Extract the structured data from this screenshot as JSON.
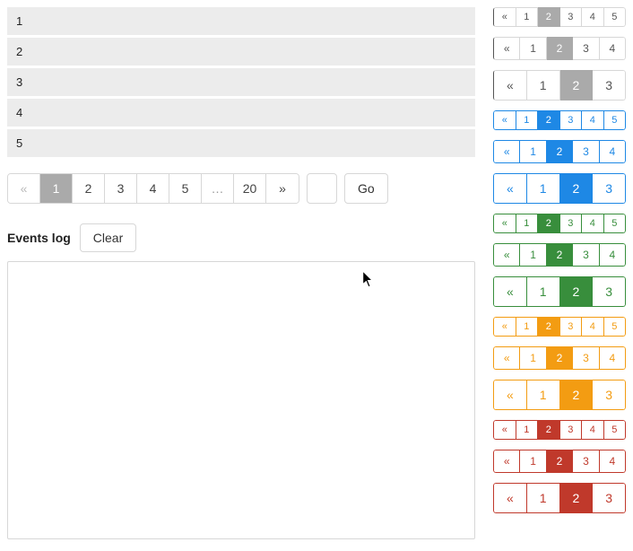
{
  "list": {
    "items": [
      "1",
      "2",
      "3",
      "4",
      "5"
    ]
  },
  "pager": {
    "prev": "«",
    "pages": [
      "1",
      "2",
      "3",
      "4",
      "5"
    ],
    "dots": "…",
    "last": "20",
    "next": "»",
    "active_index": 0
  },
  "page_input": {
    "value": ""
  },
  "go": {
    "label": "Go"
  },
  "events": {
    "title": "Events log",
    "clear_label": "Clear"
  },
  "minis": [
    {
      "color": "gray",
      "size": "s",
      "cells": [
        "«",
        "1",
        "2",
        "3",
        "4",
        "5"
      ],
      "active": 2
    },
    {
      "color": "gray",
      "size": "m",
      "cells": [
        "«",
        "1",
        "2",
        "3",
        "4"
      ],
      "active": 2
    },
    {
      "color": "gray",
      "size": "l",
      "cells": [
        "«",
        "1",
        "2",
        "3"
      ],
      "active": 2
    },
    {
      "color": "blue",
      "size": "s",
      "cells": [
        "«",
        "1",
        "2",
        "3",
        "4",
        "5"
      ],
      "active": 2
    },
    {
      "color": "blue",
      "size": "m",
      "cells": [
        "«",
        "1",
        "2",
        "3",
        "4"
      ],
      "active": 2
    },
    {
      "color": "blue",
      "size": "l",
      "cells": [
        "«",
        "1",
        "2",
        "3"
      ],
      "active": 2
    },
    {
      "color": "green",
      "size": "s",
      "cells": [
        "«",
        "1",
        "2",
        "3",
        "4",
        "5"
      ],
      "active": 2
    },
    {
      "color": "green",
      "size": "m",
      "cells": [
        "«",
        "1",
        "2",
        "3",
        "4"
      ],
      "active": 2
    },
    {
      "color": "green",
      "size": "l",
      "cells": [
        "«",
        "1",
        "2",
        "3"
      ],
      "active": 2
    },
    {
      "color": "orange",
      "size": "s",
      "cells": [
        "«",
        "1",
        "2",
        "3",
        "4",
        "5"
      ],
      "active": 2
    },
    {
      "color": "orange",
      "size": "m",
      "cells": [
        "«",
        "1",
        "2",
        "3",
        "4"
      ],
      "active": 2
    },
    {
      "color": "orange",
      "size": "l",
      "cells": [
        "«",
        "1",
        "2",
        "3"
      ],
      "active": 2
    },
    {
      "color": "red",
      "size": "s",
      "cells": [
        "«",
        "1",
        "2",
        "3",
        "4",
        "5"
      ],
      "active": 2
    },
    {
      "color": "red",
      "size": "m",
      "cells": [
        "«",
        "1",
        "2",
        "3",
        "4"
      ],
      "active": 2
    },
    {
      "color": "red",
      "size": "l",
      "cells": [
        "«",
        "1",
        "2",
        "3"
      ],
      "active": 2
    }
  ]
}
